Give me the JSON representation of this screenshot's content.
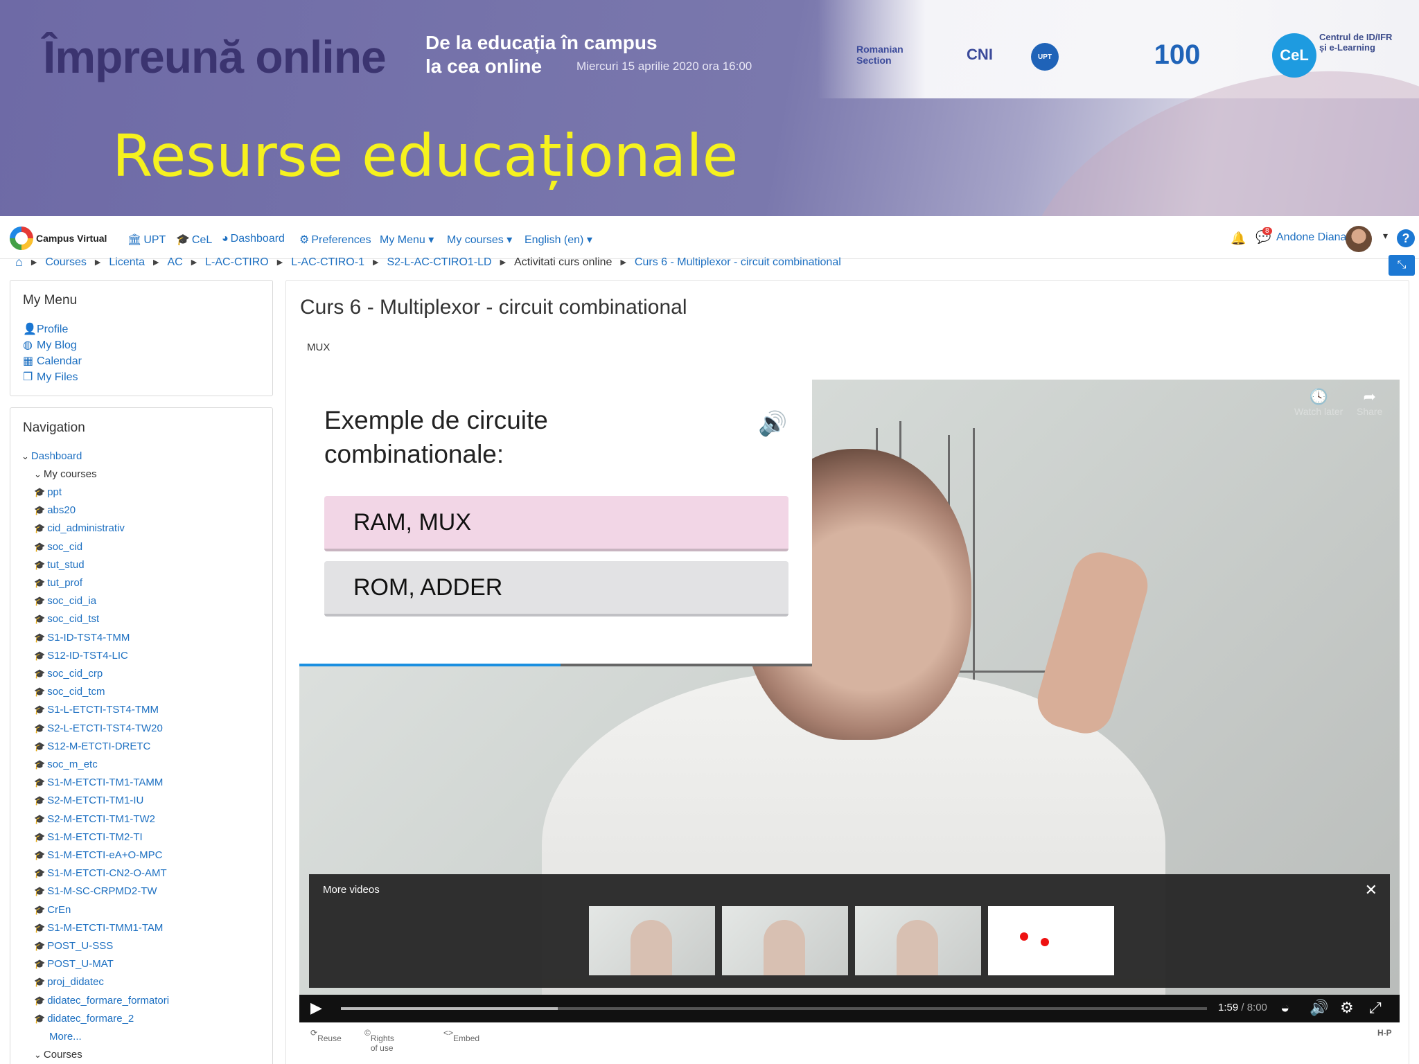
{
  "banner": {
    "brand": "Împreună online",
    "tagline_line1": "De la educația în campus",
    "tagline_line2": "la cea online",
    "date": "Miercuri 15 aprilie 2020 ora 16:00",
    "logos": [
      "Romanian Section",
      "CNI",
      "UPT",
      "100",
      "CeL"
    ],
    "cel_text_line1": "Centrul de ID/IFR",
    "cel_text_line2": "și e-Learning",
    "slide_title": "Resurse educaționale"
  },
  "navbar": {
    "brand": "Campus Virtual",
    "links": [
      {
        "label": "UPT",
        "icon": "university-icon"
      },
      {
        "label": "CeL",
        "icon": "graduation-cap-icon"
      },
      {
        "label": "Dashboard",
        "icon": "dashboard-icon"
      },
      {
        "label": "Preferences",
        "icon": "gear-icon"
      },
      {
        "label": "My Menu",
        "icon": "caret-down-icon"
      },
      {
        "label": "My courses",
        "icon": "caret-down-icon"
      },
      {
        "label": "English (en)",
        "icon": "caret-down-icon"
      }
    ],
    "notification_count": "8",
    "user_name": "Andone Diana"
  },
  "breadcrumb": [
    "Courses",
    "Licenta",
    "AC",
    "L-AC-CTIRO",
    "L-AC-CTIRO-1",
    "S2-L-AC-CTIRO1-LD",
    "Activitati curs online",
    "Curs 6 - Multiplexor - circuit combinational"
  ],
  "my_menu": {
    "title": "My Menu",
    "items": [
      "Profile",
      "My Blog",
      "Calendar",
      "My Files"
    ]
  },
  "navigation": {
    "title": "Navigation",
    "dashboard": "Dashboard",
    "my_courses": "My courses",
    "courses": [
      "ppt",
      "abs20",
      "cid_administrativ",
      "soc_cid",
      "tut_stud",
      "tut_prof",
      "soc_cid_ia",
      "soc_cid_tst",
      "S1-ID-TST4-TMM",
      "S12-ID-TST4-LIC",
      "soc_cid_crp",
      "soc_cid_tcm",
      "S1-L-ETCTI-TST4-TMM",
      "S2-L-ETCTI-TST4-TW20",
      "S12-M-ETCTI-DRETC",
      "soc_m_etc",
      "S1-M-ETCTI-TM1-TAMM",
      "S2-M-ETCTI-TM1-IU",
      "S2-M-ETCTI-TM1-TW2",
      "S1-M-ETCTI-TM2-TI",
      "S1-M-ETCTI-eA+O-MPC",
      "S1-M-ETCTI-CN2-O-AMT",
      "S1-M-SC-CRPMD2-TW",
      "CrEn",
      "S1-M-ETCTI-TMM1-TAM",
      "POST_U-SSS",
      "POST_U-MAT",
      "proj_didatec",
      "didatec_formare_formatori",
      "didatec_formare_2"
    ],
    "more": "More...",
    "courses_label": "Courses"
  },
  "main": {
    "title": "Curs 6 - Multiplexor - circuit combinational",
    "subtitle": "MUX"
  },
  "video": {
    "quiz_question": "Exemple de circuite combinationale:",
    "option_a": "RAM, MUX",
    "option_b": "ROM, ADDER",
    "quiz_progress_fraction": 0.51,
    "watch_later": "Watch later",
    "share": "Share",
    "more_videos": "More videos",
    "time_current": "1:59",
    "time_total": "/ 8:00",
    "progress_fraction": 0.25,
    "reuse": "Reuse",
    "rights": "Rights of use",
    "embed": "Embed",
    "h5p": "H-P"
  }
}
